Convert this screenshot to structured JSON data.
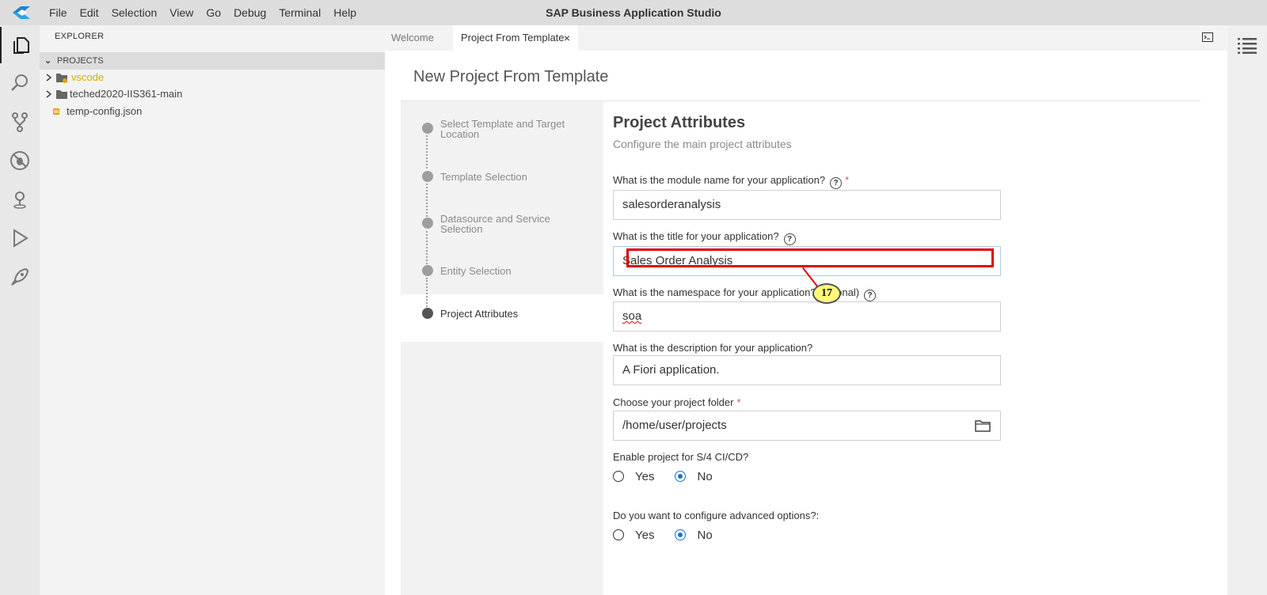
{
  "menu": [
    "File",
    "Edit",
    "Selection",
    "View",
    "Go",
    "Debug",
    "Terminal",
    "Help"
  ],
  "app_title": "SAP Business Application Studio",
  "activity_bar": [
    {
      "icon": "files-icon",
      "active": true
    },
    {
      "icon": "search-icon"
    },
    {
      "icon": "source-control-icon"
    },
    {
      "icon": "no-debug-icon"
    },
    {
      "icon": "location-pin-icon"
    },
    {
      "icon": "run-icon"
    },
    {
      "icon": "rocket-icon"
    }
  ],
  "sidebar": {
    "title": "EXPLORER",
    "section": "PROJECTS",
    "items": [
      {
        "label": "vscode",
        "type": "folder",
        "color": "#e0a600"
      },
      {
        "label": "teched2020-IIS361-main",
        "type": "folder"
      },
      {
        "label": "temp-config.json",
        "type": "file"
      }
    ]
  },
  "tabs": [
    {
      "label": "Welcome",
      "active": false
    },
    {
      "label": "Project From Template",
      "active": true,
      "close": "×"
    }
  ],
  "page": {
    "title": "New Project From Template",
    "steps": [
      {
        "label": "Select Template and Target Location"
      },
      {
        "label": "Template Selection"
      },
      {
        "label": "Datasource and Service Selection"
      },
      {
        "label": "Entity Selection"
      },
      {
        "label": "Project Attributes",
        "current": true
      }
    ],
    "form": {
      "title": "Project Attributes",
      "subtitle": "Configure the main project attributes",
      "module_label": "What is the module name for your application?",
      "module_value": "salesorderanalysis",
      "title_label": "What is the title for your application?",
      "title_value": "Sales Order Analysis",
      "namespace_label": "What is the namespace for your application?",
      "namespace_suffix": "onal)",
      "namespace_value": "soa",
      "description_label": "What is the description for your application?",
      "description_value": "A Fiori application.",
      "folder_label": "Choose your project folder",
      "folder_value": "/home/user/projects",
      "cicd_label": "Enable project for S/4 CI/CD?",
      "cicd_selected": "No",
      "advanced_label": "Do you want to configure advanced options?:",
      "advanced_selected": "No",
      "yes_label": "Yes",
      "no_label": "No",
      "required_mark": "*",
      "help_glyph": "?"
    }
  },
  "annotation": {
    "badge": "17",
    "color": "#e00000"
  }
}
